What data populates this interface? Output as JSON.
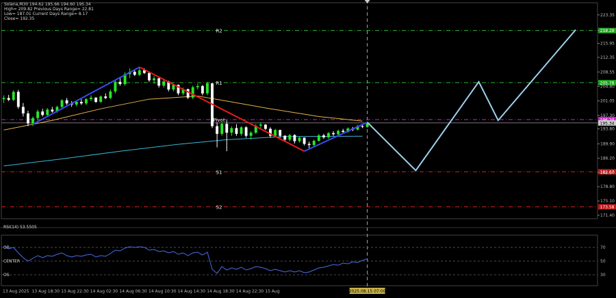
{
  "header": {
    "symbol_line": "Solana,M30  194.62 195.66 194.60 195.34",
    "line2": "High= 209.82   Previous Days Range= 22.81",
    "line3": "Low= 187.01   Current Days Range= 8.17",
    "line4": "Close= 192.35"
  },
  "rsi_panel": {
    "label": "RSI(14) 53.5505",
    "levels": [
      {
        "text": "OB",
        "value": 70
      },
      {
        "text": "CENTER",
        "value": 50
      },
      {
        "text": "OS",
        "value": 30
      }
    ],
    "y_ticks": [
      70,
      50,
      30
    ],
    "ylim": [
      14,
      88
    ]
  },
  "colors": {
    "background": "#000000",
    "bull_candle": "#27e827",
    "bear_candle": "#ffffff",
    "up_trend": "#3a4cf0",
    "down_trend": "#e81c1c",
    "projection": "#9dd2ee",
    "ma_slow": "#e8b24a",
    "ma_long": "#3ab8d8",
    "rsi_line": "#4a6ee8",
    "green_badge": "#1fa31f",
    "red_badge": "#c01818",
    "magenta_badge": "#d020d0"
  },
  "chart_data": {
    "type": "candlestick",
    "symbol": "Solana",
    "timeframe": "M30",
    "ylim": [
      170.5,
      226.5
    ],
    "y_ticks": [
      "223.35",
      "219.29",
      "215.95",
      "212.35",
      "208.55",
      "204.80",
      "201.05",
      "197.30",
      "193.80",
      "189.90",
      "186.20",
      "182.50",
      "178.80",
      "175.10",
      "171.40"
    ],
    "x_ticks": [
      "13 Aug 2025",
      "13 Aug 18:30",
      "13 Aug 22:30",
      "14 Aug 02:30",
      "14 Aug 06:30",
      "14 Aug 10:30",
      "14 Aug 14:30",
      "14 Aug 18:30",
      "14 Aug 22:30",
      "15 Aug",
      "2025.08.15 07:00"
    ],
    "candles": [
      [
        201.5,
        202.5,
        200.5,
        201.8
      ],
      [
        201.8,
        202.6,
        201.0,
        201.3
      ],
      [
        201.3,
        203.8,
        201.0,
        203.4
      ],
      [
        203.4,
        203.9,
        199.0,
        199.5
      ],
      [
        199.5,
        200.5,
        197.0,
        197.8
      ],
      [
        197.8,
        198.5,
        194.5,
        195.2
      ],
      [
        195.2,
        197.0,
        194.5,
        196.6
      ],
      [
        196.6,
        198.8,
        196.0,
        198.3
      ],
      [
        198.3,
        199.0,
        197.0,
        197.4
      ],
      [
        197.4,
        199.2,
        197.0,
        198.8
      ],
      [
        198.8,
        199.5,
        198.0,
        198.3
      ],
      [
        198.3,
        199.8,
        198.0,
        199.5
      ],
      [
        199.5,
        201.5,
        199.0,
        201.2
      ],
      [
        201.2,
        201.8,
        200.0,
        200.4
      ],
      [
        200.4,
        201.0,
        199.5,
        200.1
      ],
      [
        200.1,
        201.0,
        199.6,
        200.8
      ],
      [
        200.8,
        201.5,
        200.0,
        200.4
      ],
      [
        200.4,
        201.8,
        200.0,
        201.5
      ],
      [
        201.5,
        202.5,
        201.0,
        201.9
      ],
      [
        201.9,
        202.0,
        200.5,
        200.8
      ],
      [
        200.8,
        202.5,
        200.5,
        202.2
      ],
      [
        202.2,
        203.0,
        201.5,
        201.8
      ],
      [
        201.8,
        204.0,
        201.5,
        203.5
      ],
      [
        203.5,
        206.5,
        203.0,
        206.0
      ],
      [
        206.0,
        207.0,
        205.0,
        205.4
      ],
      [
        205.4,
        208.5,
        205.0,
        208.0
      ],
      [
        208.0,
        209.5,
        207.0,
        208.6
      ],
      [
        208.6,
        209.0,
        207.5,
        207.8
      ],
      [
        207.8,
        209.8,
        207.5,
        209.0
      ],
      [
        209.0,
        209.5,
        208.0,
        208.3
      ],
      [
        208.3,
        208.5,
        206.0,
        206.4
      ],
      [
        206.4,
        207.5,
        205.5,
        206.9
      ],
      [
        206.9,
        207.0,
        204.5,
        205.0
      ],
      [
        205.0,
        206.5,
        204.5,
        206.1
      ],
      [
        206.1,
        206.3,
        203.5,
        204.0
      ],
      [
        204.0,
        205.5,
        203.5,
        205.2
      ],
      [
        205.2,
        205.3,
        202.5,
        203.0
      ],
      [
        203.0,
        204.5,
        202.5,
        204.1
      ],
      [
        204.1,
        204.2,
        201.5,
        201.9
      ],
      [
        201.9,
        205.0,
        201.5,
        204.6
      ],
      [
        204.6,
        205.5,
        204.0,
        204.9
      ],
      [
        204.9,
        205.2,
        202.5,
        203.0
      ],
      [
        203.0,
        206.0,
        202.5,
        205.6
      ],
      [
        205.6,
        205.7,
        194.0,
        194.5
      ],
      [
        194.5,
        195.5,
        189.0,
        192.5
      ],
      [
        192.5,
        195.5,
        192.0,
        195.1
      ],
      [
        195.1,
        196.0,
        188.0,
        192.8
      ],
      [
        192.8,
        194.5,
        192.0,
        194.0
      ],
      [
        194.0,
        195.0,
        192.0,
        192.5
      ],
      [
        192.5,
        194.5,
        192.0,
        194.2
      ],
      [
        194.2,
        194.5,
        191.5,
        192.0
      ],
      [
        192.0,
        193.2,
        191.0,
        192.8
      ],
      [
        192.8,
        195.0,
        192.5,
        194.6
      ],
      [
        194.6,
        195.5,
        194.0,
        194.9
      ],
      [
        194.9,
        195.0,
        193.5,
        193.8
      ],
      [
        193.8,
        194.2,
        191.5,
        192.0
      ],
      [
        192.0,
        193.8,
        191.8,
        193.5
      ],
      [
        193.5,
        193.6,
        191.5,
        192.0
      ],
      [
        192.0,
        192.2,
        190.5,
        191.0
      ],
      [
        191.0,
        192.5,
        190.5,
        192.2
      ],
      [
        192.2,
        192.4,
        190.0,
        190.6
      ],
      [
        190.6,
        191.8,
        190.2,
        191.5
      ],
      [
        191.5,
        191.6,
        189.5,
        189.9
      ],
      [
        189.9,
        190.5,
        188.5,
        189.6
      ],
      [
        189.6,
        191.0,
        189.2,
        190.7
      ],
      [
        190.7,
        192.5,
        190.5,
        192.1
      ],
      [
        192.1,
        192.5,
        191.2,
        191.6
      ],
      [
        191.6,
        193.0,
        191.2,
        192.7
      ],
      [
        192.7,
        193.2,
        192.0,
        192.4
      ],
      [
        192.4,
        193.6,
        192.0,
        193.3
      ],
      [
        193.3,
        193.8,
        192.8,
        193.0
      ],
      [
        193.0,
        194.2,
        192.8,
        193.9
      ],
      [
        193.9,
        194.3,
        193.2,
        193.6
      ],
      [
        193.6,
        194.8,
        193.4,
        194.5
      ],
      [
        194.5,
        195.0,
        194.0,
        194.3
      ],
      [
        194.3,
        195.6,
        194.1,
        195.3
      ]
    ],
    "pivot_levels": [
      {
        "label": "R2",
        "value": 219.29,
        "color": "#2fb82f",
        "badge": "219.29"
      },
      {
        "label": "R1",
        "value": 205.78,
        "color": "#2fb82f",
        "badge": "205.78"
      },
      {
        "label": "Pivot",
        "value": 196.2,
        "color": "#d020d0",
        "badge": "196.20"
      },
      {
        "label": "S1",
        "value": 182.67,
        "color": "#d02020",
        "badge": "182.67"
      },
      {
        "label": "S2",
        "value": 173.58,
        "color": "#d02020",
        "badge": "173.58"
      }
    ],
    "current_price": {
      "value": 195.34,
      "badge": "195.34"
    },
    "trend_lines": [
      {
        "name": "up",
        "from": [
          6,
          195.0
        ],
        "to": [
          28,
          209.8
        ],
        "color": "#3a4cf0"
      },
      {
        "name": "down",
        "from": [
          28,
          209.8
        ],
        "to": [
          62,
          188.0
        ],
        "color": "#e81c1c"
      },
      {
        "name": "up",
        "from": [
          62,
          188.0
        ],
        "to": [
          75,
          195.5
        ],
        "color": "#3a4cf0"
      }
    ],
    "projection": {
      "color": "#9dd2ee",
      "points": [
        [
          75,
          195.5
        ],
        [
          85,
          183.0
        ],
        [
          98,
          206.0
        ],
        [
          102,
          196.0
        ],
        [
          118,
          219.5
        ]
      ]
    },
    "moving_averages": [
      {
        "name": "ma_slow",
        "color": "#e8b24a",
        "points": [
          [
            0,
            193.5
          ],
          [
            10,
            196.0
          ],
          [
            20,
            199.0
          ],
          [
            30,
            201.5
          ],
          [
            40,
            202.3
          ],
          [
            46,
            201.0
          ],
          [
            55,
            199.0
          ],
          [
            65,
            197.0
          ],
          [
            74,
            195.8
          ]
        ]
      },
      {
        "name": "ma_long",
        "color": "#3ab8d8",
        "points": [
          [
            0,
            184.2
          ],
          [
            12,
            186.0
          ],
          [
            24,
            188.0
          ],
          [
            36,
            189.8
          ],
          [
            46,
            191.0
          ],
          [
            58,
            191.8
          ],
          [
            74,
            191.9
          ]
        ]
      }
    ],
    "rsi": [
      72,
      68,
      70,
      62,
      55,
      50,
      54,
      58,
      55,
      58,
      57,
      60,
      62,
      58,
      56,
      58,
      57,
      59,
      60,
      56,
      58,
      57,
      61,
      66,
      65,
      69,
      71,
      70,
      71,
      70,
      66,
      67,
      64,
      65,
      62,
      64,
      60,
      62,
      58,
      62,
      63,
      59,
      63,
      38,
      32,
      42,
      37,
      40,
      38,
      41,
      37,
      39,
      42,
      41,
      39,
      36,
      38,
      36,
      34,
      36,
      34,
      36,
      33,
      34,
      37,
      40,
      41,
      43,
      45,
      44,
      47,
      46,
      49,
      48,
      51,
      53.55
    ]
  }
}
